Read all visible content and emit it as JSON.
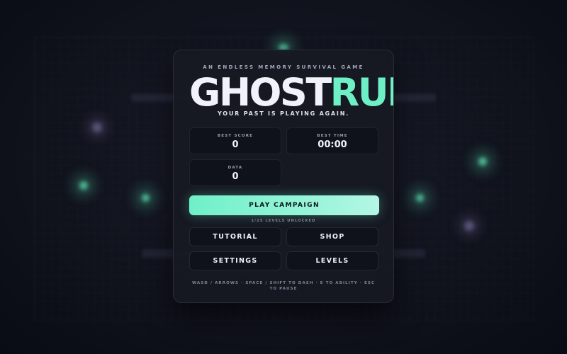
{
  "game": {
    "tagline": "AN ENDLESS MEMORY SURVIVAL GAME",
    "title_part1": "GHOST",
    "title_part2": "RUN",
    "subtitle": "YOUR PAST IS PLAYING AGAIN.",
    "accent_color": "#6ef0c6"
  },
  "stats": {
    "best_score": {
      "label": "BEST SCORE",
      "value": "0"
    },
    "best_time": {
      "label": "BEST TIME",
      "value": "00:00"
    },
    "data": {
      "label": "DATA",
      "value": "0"
    }
  },
  "menu": {
    "play_label": "PLAY CAMPAIGN",
    "levels_unlocked": "1/25 LEVELS UNLOCKED",
    "tutorial_label": "TUTORIAL",
    "shop_label": "SHOP",
    "settings_label": "SETTINGS",
    "levels_label": "LEVELS"
  },
  "controls_hint": "WASD / ARROWS · SPACE / SHIFT TO DASH · E TO ABILITY · ESC TO PAUSE"
}
